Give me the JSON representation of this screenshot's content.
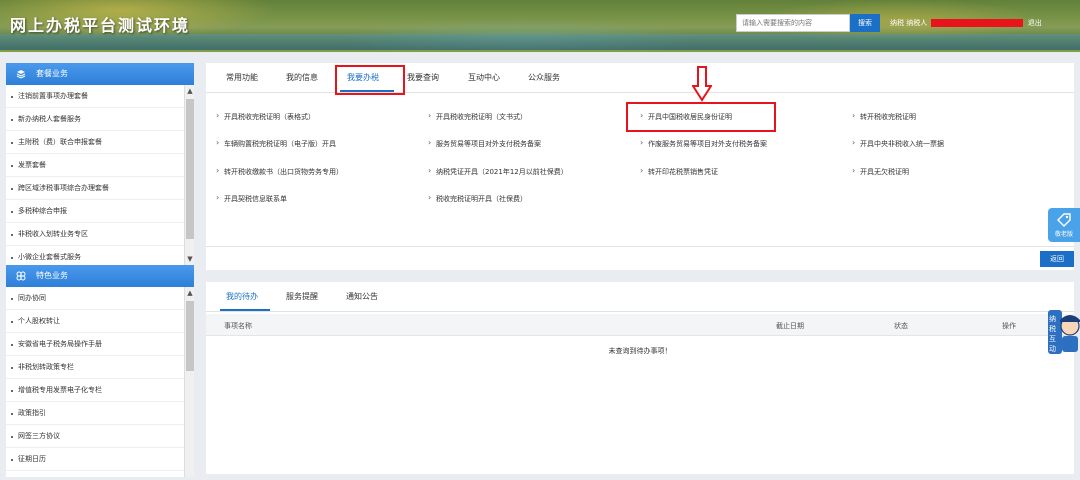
{
  "header": {
    "title": "网上办税平台测试环境",
    "search_placeholder": "请输入需要搜索的内容",
    "search_button": "搜索",
    "user_prefix": "纳税",
    "user_mid": "纳税人",
    "logout": "退出"
  },
  "sidebar": {
    "section1": {
      "title": "套餐业务",
      "items": [
        "注销前置事项办理套餐",
        "新办纳税人套餐服务",
        "主附税（费）联合申报套餐",
        "发票套餐",
        "跨区域涉税事项综合办理套餐",
        "多税种综合申报",
        "非税收入划转业务专区",
        "小微企业套餐式服务"
      ]
    },
    "section2": {
      "title": "特色业务",
      "items": [
        "同办协同",
        "个人股权转让",
        "安徽省电子税务局操作手册",
        "非税划转政策专栏",
        "增值税专用发票电子化专栏",
        "政策指引",
        "网签三方协议",
        "征期日历"
      ]
    }
  },
  "main": {
    "tabs": [
      "常用功能",
      "我的信息",
      "我要办税",
      "我要查询",
      "互动中心",
      "公众服务"
    ],
    "links": [
      [
        "开具税收完税证明（表格式）",
        "开具税收完税证明（文书式）",
        "开具中国税收居民身份证明",
        "转开税收完税证明"
      ],
      [
        "车辆购置税完税证明（电子版）开具",
        "服务贸易等项目对外支付税务备案",
        "作废服务贸易等项目对外支付税务备案",
        "开具中央非税收入统一票据"
      ],
      [
        "转开税收缴款书（出口货物劳务专用）",
        "纳税凭证开具（2021年12月以前社保费）",
        "转开印花税票销售凭证",
        "开具无欠税证明"
      ],
      [
        "开具契税信息联系单",
        "税收完税证明开具（社保费）"
      ]
    ],
    "back_button": "返回"
  },
  "bottom": {
    "tabs": [
      "我的待办",
      "服务提醒",
      "通知公告"
    ],
    "columns": [
      "事项名称",
      "截止日期",
      "状态",
      "操作"
    ],
    "empty": "未查询到待办事项！"
  },
  "widgets": {
    "elder_label": "敬老版",
    "mascot_text": "纳税互动"
  },
  "colors": {
    "accent": "#1b6fc7",
    "highlight": "#e8141b",
    "sidebar_head": "#3b8de0"
  }
}
